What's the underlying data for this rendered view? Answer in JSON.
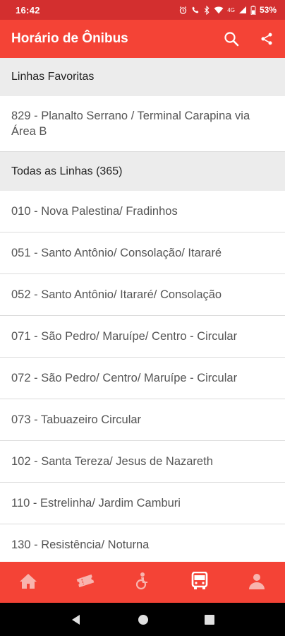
{
  "status_bar": {
    "time": "16:42",
    "network": "4G",
    "battery": "53%"
  },
  "app_bar": {
    "title": "Horário de Ônibus",
    "search_icon": "search-icon",
    "share_icon": "share-icon"
  },
  "favorites": {
    "header": "Linhas Favoritas",
    "items": [
      {
        "label": "829 - Planalto Serrano / Terminal Carapina via Área B"
      }
    ]
  },
  "all_lines": {
    "header": "Todas as Linhas (365)",
    "items": [
      {
        "label": "010 - Nova Palestina/ Fradinhos"
      },
      {
        "label": "051 - Santo Antônio/ Consolação/ Itararé"
      },
      {
        "label": "052 - Santo Antônio/ Itararé/ Consolação"
      },
      {
        "label": "071 - São Pedro/ Maruípe/ Centro - Circular"
      },
      {
        "label": "072 - São Pedro/ Centro/ Maruípe - Circular"
      },
      {
        "label": "073 - Tabuazeiro Circular"
      },
      {
        "label": "102 - Santa Tereza/ Jesus de Nazareth"
      },
      {
        "label": "110 - Estrelinha/ Jardim Camburi"
      },
      {
        "label": "130 - Resistência/ Noturna"
      }
    ]
  },
  "bottom_nav": {
    "items": [
      {
        "icon": "home-icon",
        "active": false
      },
      {
        "icon": "ticket-icon",
        "active": false
      },
      {
        "icon": "accessibility-icon",
        "active": false
      },
      {
        "icon": "bus-icon",
        "active": true
      },
      {
        "icon": "user-icon",
        "active": false
      }
    ]
  },
  "colors": {
    "status_bar": "#d32f2f",
    "app_bar": "#f44336",
    "section_bg": "#ececec",
    "divider": "#dcdcdc"
  }
}
